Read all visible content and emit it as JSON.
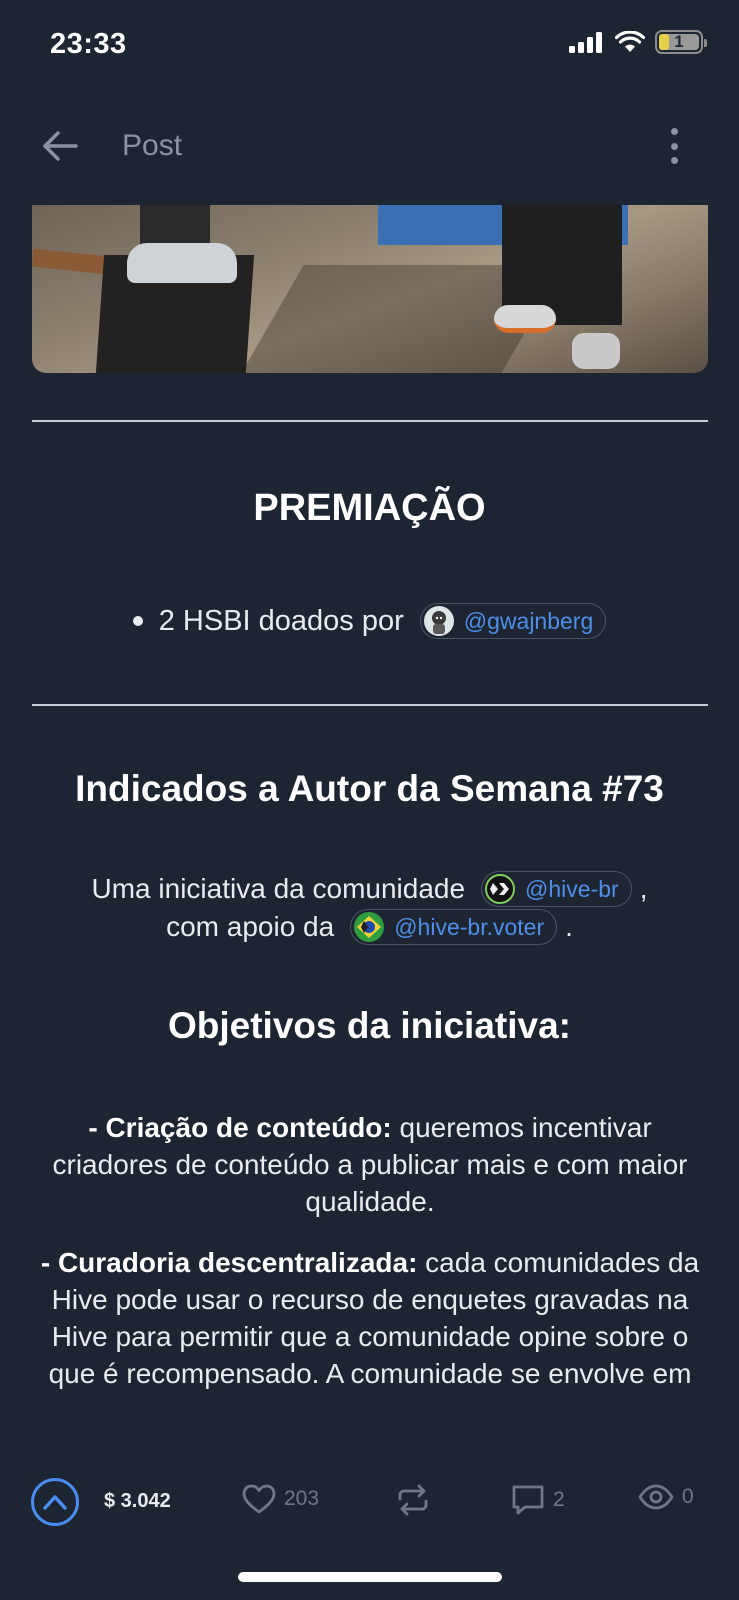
{
  "status_bar": {
    "time": "23:33",
    "battery_level": "1"
  },
  "app_bar": {
    "title": "Post"
  },
  "premiacao": {
    "heading": "PREMIAÇÃO",
    "bullet_text": "2 HSBI doados por",
    "mention": "@gwajnberg"
  },
  "indicados": {
    "heading": "Indicados a Autor da Semana #73",
    "line1_text": "Uma iniciativa da comunidade",
    "line1_mention": "@hive-br",
    "line1_suffix": ",",
    "line2_text": "com apoio da",
    "line2_mention": "@hive-br.voter",
    "line2_suffix": "."
  },
  "objetivos": {
    "heading": "Objetivos da iniciativa:",
    "item1_label": "- Criação de conteúdo:",
    "item1_text": " queremos incentivar criadores de conteúdo a publicar mais e com maior qualidade.",
    "item2_label": "- Curadoria descentralizada:",
    "item2_text": " cada comunidades da Hive pode usar o recurso de enquetes gravadas na Hive para permitir que a comunidade opine sobre o que é recompensado. A comunidade se envolve em"
  },
  "actions": {
    "payout": "$ 3.042",
    "likes": "203",
    "comments": "2",
    "views": "0"
  },
  "colors": {
    "background": "#1e2532",
    "accent": "#4a8df0",
    "mention_text": "#4f8ee8",
    "muted": "#6f7888"
  }
}
